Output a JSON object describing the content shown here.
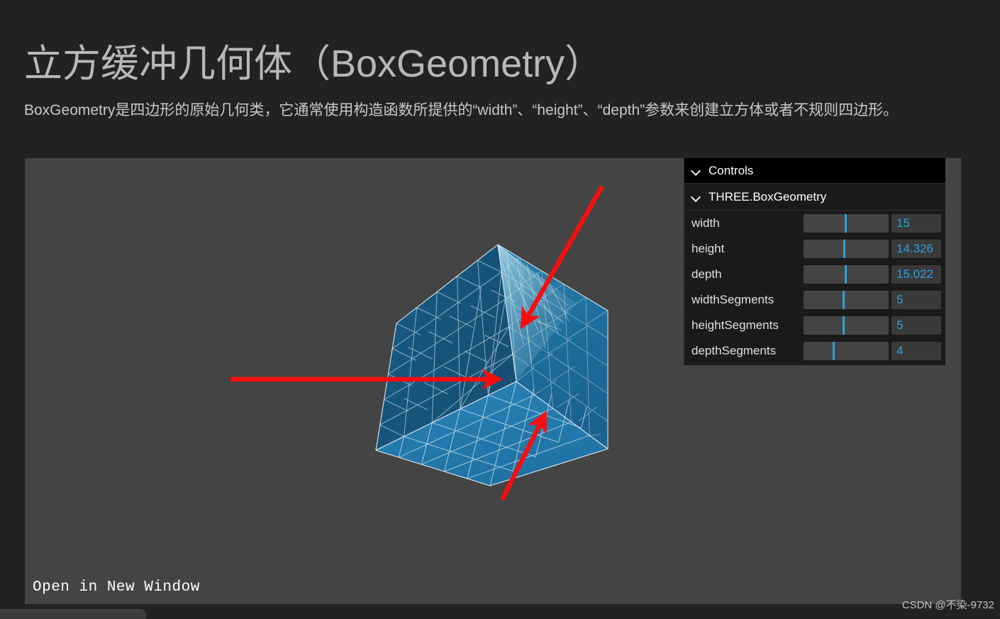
{
  "header": {
    "title": "立方缓冲几何体（BoxGeometry）",
    "description": "BoxGeometry是四边形的原始几何类，它通常使用构造函数所提供的“width”、“height”、“depth”参数来创建立方体或者不规则四边形。"
  },
  "viewer": {
    "open_in_new_window": "Open in New Window",
    "background_color": "#444444",
    "cube": {
      "face_left_color": "#18567c",
      "face_bottom_color": "#2179ae",
      "face_right_color": "#1d6d9b",
      "face_inner_color": "#5f9fc0",
      "wireframe_color": "#cfe2ee"
    },
    "annotations": {
      "arrow_color": "#fb0d0d",
      "arrow_count": 3
    }
  },
  "gui": {
    "close_bar": {
      "label": "Controls",
      "icon": "chevron-down-icon"
    },
    "folder": {
      "label": "THREE.BoxGeometry",
      "icon": "chevron-down-icon"
    },
    "accent_color": "#2fa1d6",
    "rows": [
      {
        "label": "width",
        "value": "15",
        "knob_pct": 48
      },
      {
        "label": "height",
        "value": "14.326",
        "knob_pct": 47
      },
      {
        "label": "depth",
        "value": "15.022",
        "knob_pct": 48
      },
      {
        "label": "widthSegments",
        "value": "5",
        "knob_pct": 46
      },
      {
        "label": "heightSegments",
        "value": "5",
        "knob_pct": 46
      },
      {
        "label": "depthSegments",
        "value": "4",
        "knob_pct": 34
      }
    ]
  },
  "watermark": {
    "text": "CSDN @不染-9732"
  }
}
